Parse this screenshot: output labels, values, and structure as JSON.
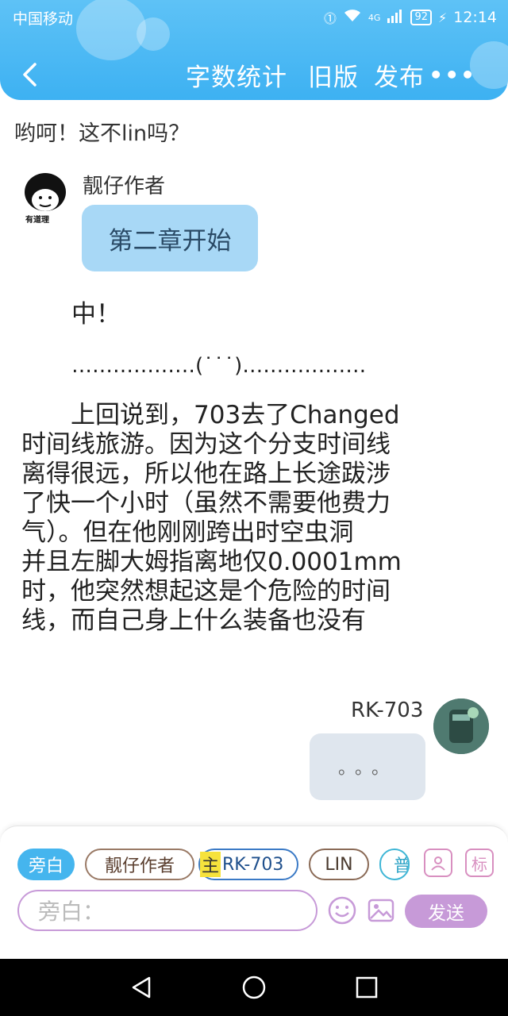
{
  "status_bar": {
    "carrier": "中国移动",
    "battery": "92",
    "time": "12:14",
    "network": "4G"
  },
  "nav": {
    "word_count": "字数统计",
    "old_version": "旧版",
    "publish": "发布"
  },
  "content": {
    "top_line": "哟呵！这不lin吗？",
    "author_name": "靓仔作者",
    "avatar_caption": "有道理",
    "chapter_bubble": "第二章开始",
    "narration_1": "中！",
    "narration_2": "………………(˙˙˙)………………",
    "paragraph_lines": [
      "　　上回说到，703去了Changed",
      "时间线旅游。因为这个分支时间线",
      "离得很远，所以他在路上长途跋涉",
      "了快一个小时（虽然不需要他费力",
      "气）。但在他刚刚跨出时空虫洞",
      "并且左脚大姆指离地仅0.0001mm",
      "时，他突然想起这是个危险的时间",
      "线，而自己身上什么装备也没有"
    ],
    "rk_name": "RK-703",
    "rk_bubble": "。。。"
  },
  "bottom": {
    "chips": {
      "aside": "旁白",
      "author": "靓仔作者",
      "zhu": "主",
      "rk": "RK-703",
      "lin": "LIN",
      "pu": "普"
    },
    "tag_label": "标",
    "input_placeholder": "旁白：",
    "send": "发送"
  }
}
